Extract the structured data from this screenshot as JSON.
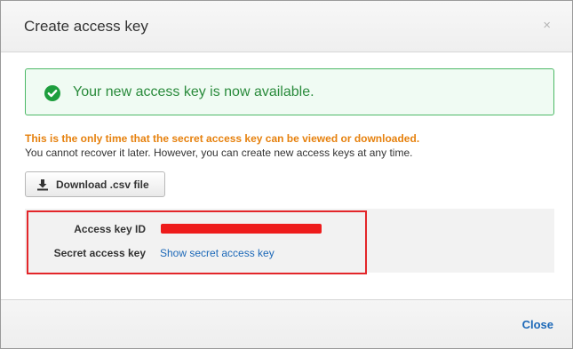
{
  "dialog": {
    "title": "Create access key",
    "close_glyph": "×"
  },
  "success": {
    "icon": "check-circle-icon",
    "message": "Your new access key is now available."
  },
  "notice": {
    "warning": "This is the only time that the secret access key can be viewed or downloaded.",
    "info": "You cannot recover it later. However, you can create new access keys at any time."
  },
  "download_button": {
    "icon": "download-icon",
    "label": "Download .csv file"
  },
  "keys": {
    "access_key_id_label": "Access key ID",
    "secret_access_key_label": "Secret access key",
    "show_secret_link": "Show secret access key"
  },
  "footer": {
    "close_label": "Close"
  },
  "colors": {
    "success_border": "#4cb966",
    "success_text": "#2a8b3c",
    "warning_text": "#e6810e",
    "link": "#1d69b8",
    "highlight": "#e3262a",
    "redaction": "#ee1c1c"
  }
}
